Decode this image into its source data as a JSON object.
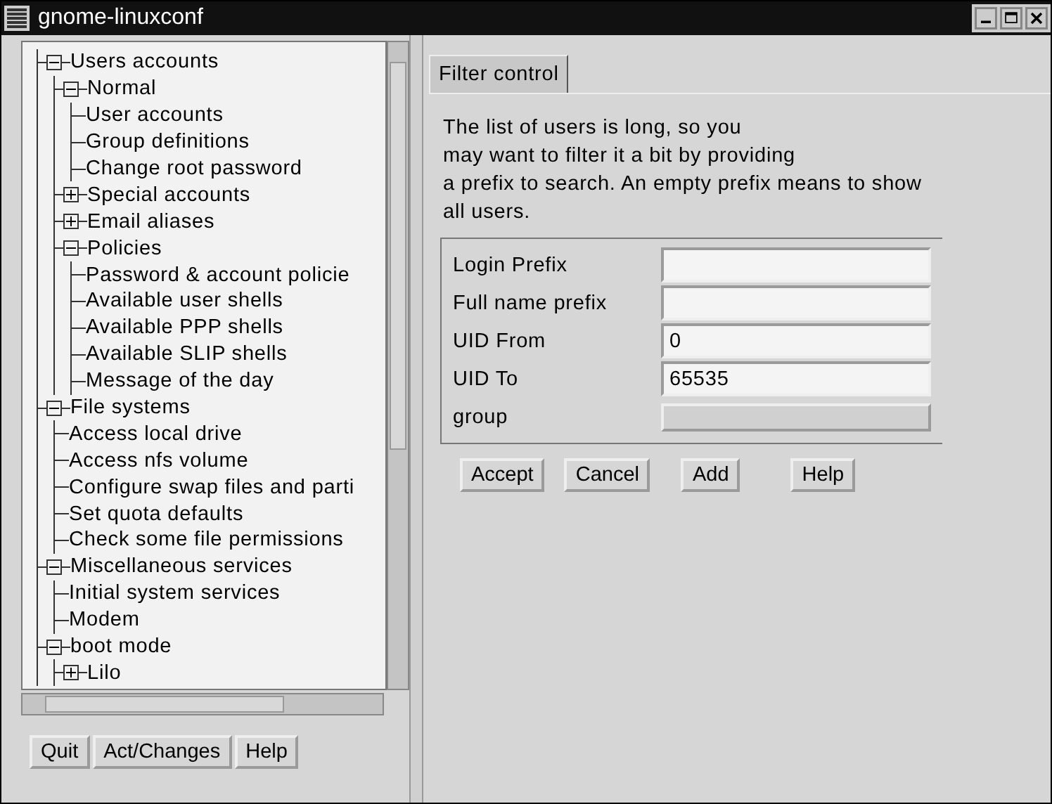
{
  "window": {
    "title": "gnome-linuxconf"
  },
  "tree": [
    {
      "label": "Users accounts",
      "expanded": true,
      "children": [
        {
          "label": "Normal",
          "expanded": true,
          "children": [
            {
              "label": "User accounts"
            },
            {
              "label": "Group definitions"
            },
            {
              "label": "Change root password"
            }
          ]
        },
        {
          "label": "Special accounts",
          "expanded": false
        },
        {
          "label": "Email aliases",
          "expanded": false
        },
        {
          "label": "Policies",
          "expanded": true,
          "children": [
            {
              "label": "Password & account policie"
            },
            {
              "label": "Available user shells"
            },
            {
              "label": "Available PPP shells"
            },
            {
              "label": "Available SLIP shells"
            },
            {
              "label": "Message of the day"
            }
          ]
        }
      ]
    },
    {
      "label": "File systems",
      "expanded": true,
      "children": [
        {
          "label": "Access local drive"
        },
        {
          "label": "Access nfs volume"
        },
        {
          "label": "Configure swap files and parti"
        },
        {
          "label": "Set quota defaults"
        },
        {
          "label": "Check some file permissions"
        }
      ]
    },
    {
      "label": "Miscellaneous services",
      "expanded": true,
      "children": [
        {
          "label": "Initial system services"
        },
        {
          "label": "Modem"
        }
      ]
    },
    {
      "label": "boot mode",
      "expanded": true,
      "children": [
        {
          "label": "Lilo",
          "expanded": false
        }
      ]
    }
  ],
  "left_buttons": [
    "Quit",
    "Act/Changes",
    "Help"
  ],
  "tabs": [
    {
      "label": "Filter control",
      "selected": true
    }
  ],
  "description": [
    "The list of users is long, so you",
    "may want to filter it a bit by providing",
    "a prefix to search. An empty prefix means to show",
    "all users."
  ],
  "fields": [
    {
      "kind": "text",
      "label": "Login Prefix"
    },
    {
      "kind": "text",
      "label": "Full name prefix"
    },
    {
      "kind": "text",
      "label": "UID From",
      "value": "0"
    },
    {
      "kind": "text",
      "label": "UID To",
      "value": "65535"
    },
    {
      "kind": "choice",
      "label": "group"
    }
  ],
  "form_buttons": [
    "Accept",
    "Cancel",
    "Add",
    "Help"
  ]
}
